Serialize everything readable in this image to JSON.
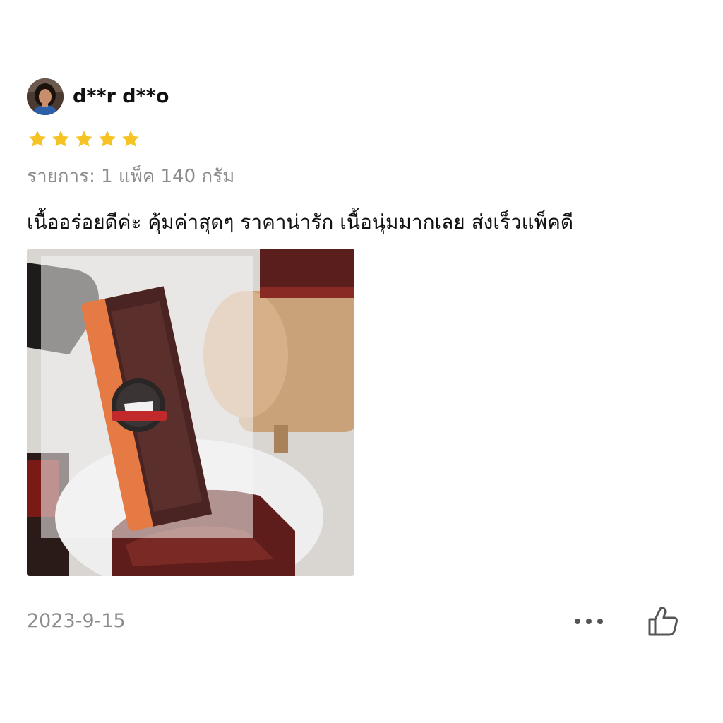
{
  "review": {
    "username": "d**r d**o",
    "rating": 5,
    "rating_max": 5,
    "variant_label": "รายการ: 1 แพ็ค 140 กรัม",
    "comment": "เนื้ออร่อยดีค่ะ คุ้มค่าสุดๆ ราคาน่ารัก เนื้อนุ่มมากเลย ส่งเร็วแพ็คดี",
    "date": "2023-9-15",
    "photo_count": 1
  },
  "colors": {
    "star": "#f6c325",
    "text_primary": "#111111",
    "text_secondary": "#8c8c8c",
    "icon": "#555555"
  },
  "icons": {
    "avatar": "user-avatar",
    "more": "more-dots-icon",
    "like": "thumbs-up-icon",
    "star": "star-icon"
  }
}
